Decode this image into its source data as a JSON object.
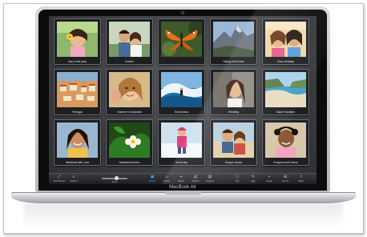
{
  "device": {
    "brand": "MacBook Air"
  },
  "photos": [
    {
      "label": "Day in the park",
      "scene": "girl-flower"
    },
    {
      "label": "Kristen",
      "scene": "couple"
    },
    {
      "label": "",
      "scene": "butterfly"
    },
    {
      "label": "Hiking Half Dome",
      "scene": "mountain"
    },
    {
      "label": "Ella's birthday",
      "scene": "girls"
    },
    {
      "label": "Portugal",
      "scene": "town"
    },
    {
      "label": "Summer in Australia",
      "scene": "girl-cheek"
    },
    {
      "label": "Surf photos",
      "scene": "wave"
    },
    {
      "label": "Wedding",
      "scene": "woman"
    },
    {
      "label": "Island Vacation",
      "scene": "coast"
    },
    {
      "label": "Weekend with Lara",
      "scene": "smiling-girl"
    },
    {
      "label": "Hawaiian flowers",
      "scene": "flowers"
    },
    {
      "label": "Snow day",
      "scene": "snow"
    },
    {
      "label": "Oregon dunes",
      "scene": "dunes"
    },
    {
      "label": "Prospect with Grace",
      "scene": "child"
    }
  ],
  "toolbar": {
    "left": [
      {
        "label": "Full Screen",
        "icon": "fullscreen-icon",
        "glyph": "⤢"
      },
      {
        "label": "Search",
        "icon": "search-icon",
        "glyph": "⌕"
      }
    ],
    "zoom": {
      "label": "Zoom",
      "level": 0.55
    },
    "center": [
      {
        "label": "Events",
        "icon": "events-icon",
        "glyph": "▣",
        "active": true
      },
      {
        "label": "Faces",
        "icon": "faces-icon",
        "glyph": "☺",
        "active": false
      },
      {
        "label": "Places",
        "icon": "places-icon",
        "glyph": "⌖",
        "active": false
      },
      {
        "label": "Albums",
        "icon": "albums-icon",
        "glyph": "▤",
        "active": false
      },
      {
        "label": "Projects",
        "icon": "projects-icon",
        "glyph": "▥",
        "active": false
      }
    ],
    "right": [
      {
        "label": "Info",
        "icon": "info-icon",
        "glyph": "ⓘ"
      },
      {
        "label": "Edit",
        "icon": "edit-icon",
        "glyph": "✎"
      },
      {
        "label": "Create",
        "icon": "create-icon",
        "glyph": "+"
      },
      {
        "label": "Add To",
        "icon": "add-to-icon",
        "glyph": "⊞"
      },
      {
        "label": "Share",
        "icon": "share-icon",
        "glyph": "⇪"
      }
    ]
  },
  "colors": {
    "accent": "#5aa9ff",
    "screen": "#3e3f42",
    "aluminum": "#c7c9cc"
  }
}
